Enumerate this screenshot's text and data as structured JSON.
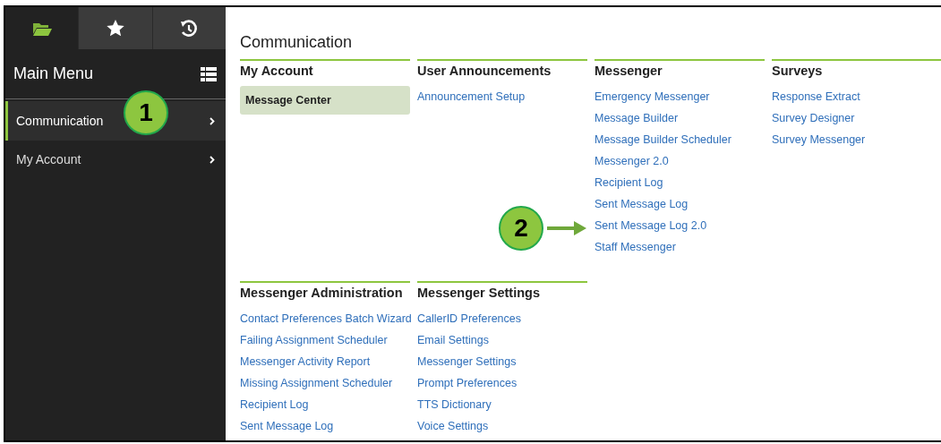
{
  "sidebar": {
    "tabs": [
      {
        "kind": "folder",
        "selected": true
      },
      {
        "kind": "star",
        "selected": false
      },
      {
        "kind": "history",
        "selected": false
      }
    ],
    "title": "Main Menu",
    "items": [
      {
        "label": "Communication",
        "selected": true
      },
      {
        "label": "My Account",
        "selected": false
      }
    ]
  },
  "page_title": "Communication",
  "sections": [
    {
      "title": "My Account",
      "links": [
        {
          "label": "Message Center",
          "selected": true
        }
      ]
    },
    {
      "title": "User Announcements",
      "links": [
        {
          "label": "Announcement Setup",
          "selected": false
        }
      ]
    },
    {
      "title": "Messenger",
      "links": [
        {
          "label": "Emergency Messenger",
          "selected": false
        },
        {
          "label": "Message Builder",
          "selected": false
        },
        {
          "label": "Message Builder Scheduler",
          "selected": false
        },
        {
          "label": "Messenger 2.0",
          "selected": false
        },
        {
          "label": "Recipient Log",
          "selected": false
        },
        {
          "label": "Sent Message Log",
          "selected": false
        },
        {
          "label": "Sent Message Log 2.0",
          "selected": false
        },
        {
          "label": "Staff Messenger",
          "selected": false
        }
      ]
    },
    {
      "title": "Surveys",
      "links": [
        {
          "label": "Response Extract",
          "selected": false
        },
        {
          "label": "Survey Designer",
          "selected": false
        },
        {
          "label": "Survey Messenger",
          "selected": false
        }
      ]
    },
    {
      "title": "Messenger Administration",
      "links": [
        {
          "label": "Contact Preferences Batch Wizard",
          "selected": false
        },
        {
          "label": "Failing Assignment Scheduler",
          "selected": false
        },
        {
          "label": "Messenger Activity Report",
          "selected": false
        },
        {
          "label": "Missing Assignment Scheduler",
          "selected": false
        },
        {
          "label": "Recipient Log",
          "selected": false
        },
        {
          "label": "Sent Message Log",
          "selected": false
        }
      ]
    },
    {
      "title": "Messenger Settings",
      "links": [
        {
          "label": "CallerID Preferences",
          "selected": false
        },
        {
          "label": "Email Settings",
          "selected": false
        },
        {
          "label": "Messenger Settings",
          "selected": false
        },
        {
          "label": "Prompt Preferences",
          "selected": false
        },
        {
          "label": "TTS Dictionary",
          "selected": false
        },
        {
          "label": "Voice Settings",
          "selected": false
        }
      ]
    }
  ],
  "callouts": [
    {
      "label": "1",
      "arrow": false
    },
    {
      "label": "2",
      "arrow": true
    }
  ]
}
